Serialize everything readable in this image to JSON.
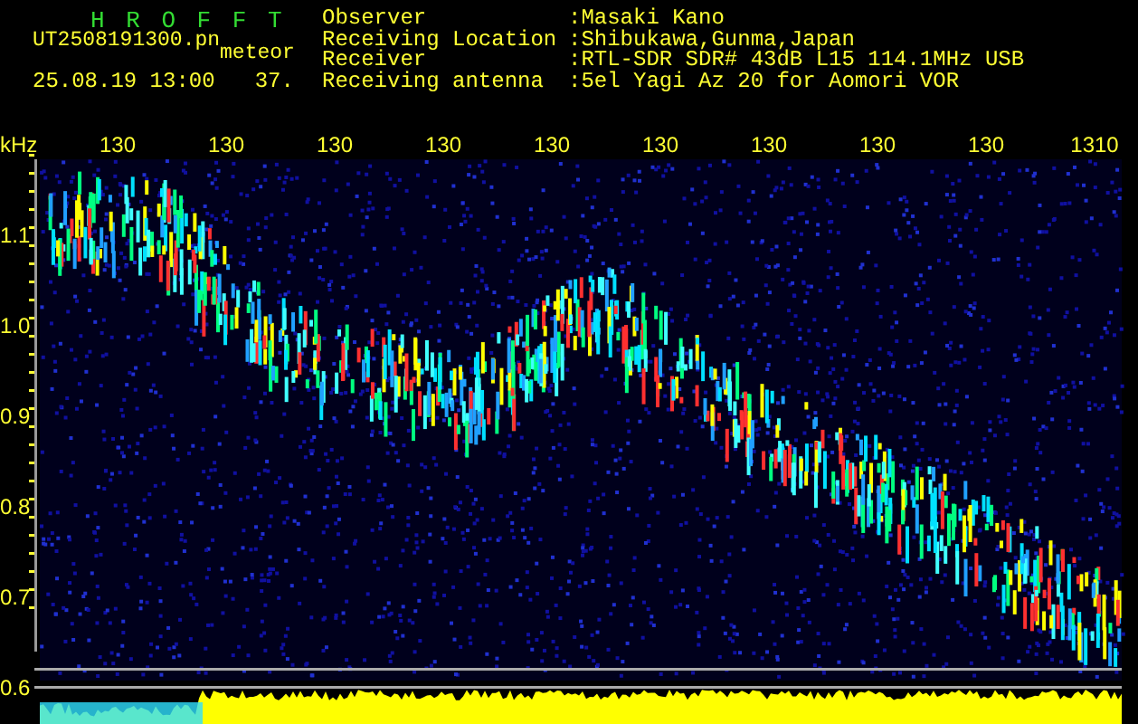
{
  "header": {
    "title": "H R O F F T",
    "file_name": "UT2508191300.pn",
    "tag": "meteor",
    "timestamp": "25.08.19 13:00",
    "count": "37.",
    "info": [
      {
        "label": "Observer",
        "value": ":Masaki Kano"
      },
      {
        "label": "Receiving Location",
        "value": ":Shibukawa,Gunma,Japan"
      },
      {
        "label": "Receiver",
        "value": ":RTL-SDR SDR# 43dB L15 114.1MHz USB"
      },
      {
        "label": "Receiving antenna",
        "value": ":5el Yagi Az 20 for Aomori VOR"
      }
    ]
  },
  "plot": {
    "y_unit": "kHz",
    "x_labels": [
      "130",
      "130",
      "130",
      "130",
      "130",
      "130",
      "130",
      "130",
      "130",
      "1310"
    ],
    "y_labels": [
      "1.1",
      "1.0",
      "0.9",
      "0.8",
      "0.7",
      "0.6"
    ]
  }
}
